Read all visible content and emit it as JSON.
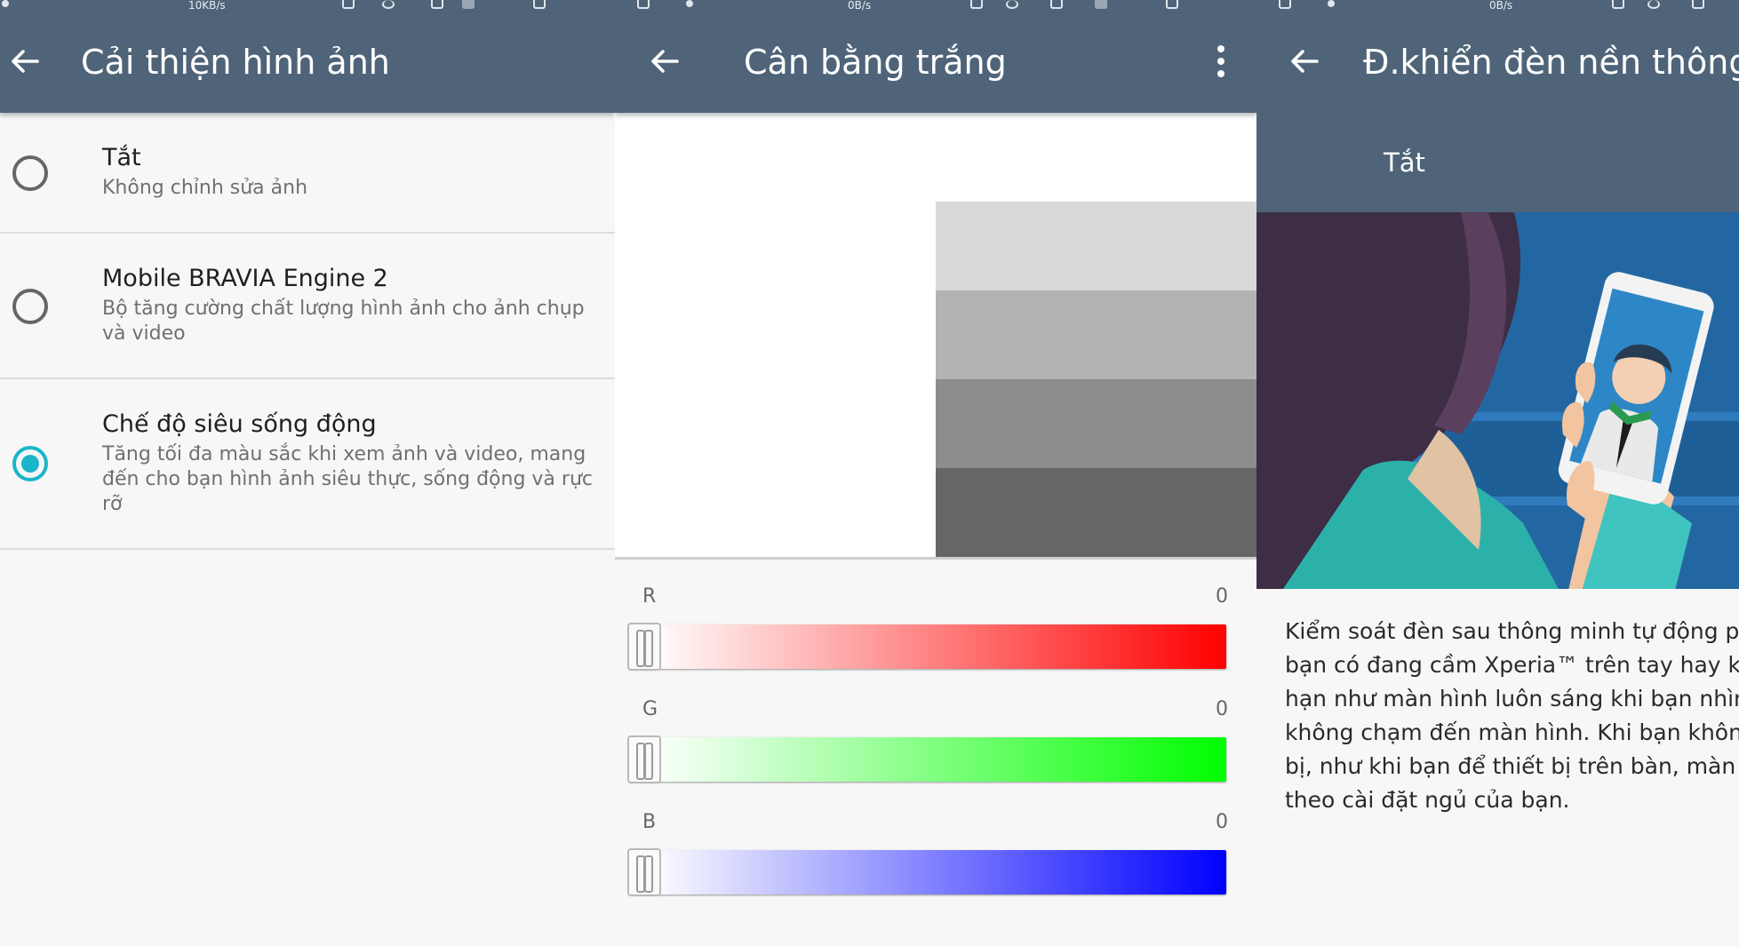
{
  "colors": {
    "appbar": "#4f6478",
    "accent": "#1ab5c8",
    "background": "#f7f7f7"
  },
  "status": {
    "panel1_speed": "10KB/s",
    "panel2_speed": "0B/s",
    "panel3_speed": "0B/s"
  },
  "image_enhancement": {
    "back_icon": "arrow-back-icon",
    "title": "Cải thiện hình ảnh",
    "options": [
      {
        "title": "Tắt",
        "subtitle": "Không chỉnh sửa ảnh",
        "selected": false
      },
      {
        "title": "Mobile BRAVIA Engine 2",
        "subtitle": "Bộ tăng cường chất lượng hình ảnh cho ảnh chụp và video",
        "selected": false
      },
      {
        "title": "Chế độ siêu sống động",
        "subtitle": "Tăng tối đa màu sắc khi xem ảnh và video, mang đến cho bạn hình ảnh siêu thực, sống động và rực rỡ",
        "selected": true
      }
    ]
  },
  "white_balance": {
    "back_icon": "arrow-back-icon",
    "title": "Cân bằng trắng",
    "menu_icon": "more-vert-icon",
    "swatches": [
      "#d9d9d9",
      "#b3b3b3",
      "#8c8c8c",
      "#666666"
    ],
    "channels": [
      {
        "label": "R",
        "value": "0",
        "color": "#ff0000"
      },
      {
        "label": "G",
        "value": "0",
        "color": "#00ff00"
      },
      {
        "label": "B",
        "value": "0",
        "color": "#0000ff"
      }
    ]
  },
  "smart_backlight": {
    "back_icon": "arrow-back-icon",
    "title": "Đ.khiển đèn nền thông minh",
    "toggle_label": "Tắt",
    "description_lines": [
      "Kiểm soát đèn sau thông minh tự động pha",
      "bạn có đang cầm Xperia™ trên tay hay khôn",
      "hạn như màn hình luôn sáng khi bạn nhìn v",
      "không chạm đến màn hình. Khi bạn không",
      "bị, như khi bạn để thiết bị trên bàn, màn hìn",
      "theo cài đặt ngủ của bạn."
    ]
  }
}
